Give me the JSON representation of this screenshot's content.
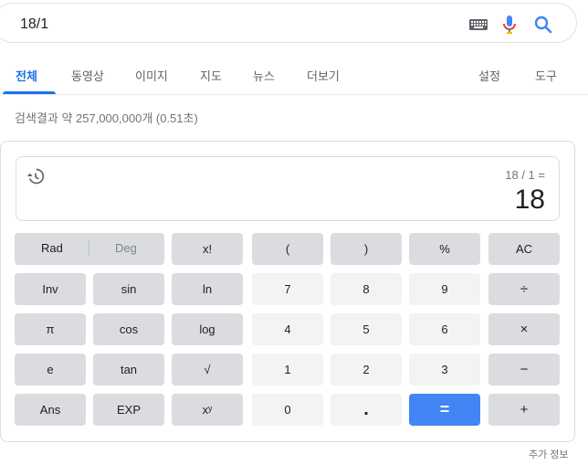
{
  "search": {
    "query": "18/1"
  },
  "tabs": [
    {
      "label": "전체",
      "active": true
    },
    {
      "label": "동영상"
    },
    {
      "label": "이미지"
    },
    {
      "label": "지도"
    },
    {
      "label": "뉴스"
    },
    {
      "label": "더보기"
    },
    {
      "label": "설정"
    },
    {
      "label": "도구"
    }
  ],
  "result_stats": "검색결과 약 257,000,000개 (0.51초)",
  "calculator": {
    "expression": "18 / 1 =",
    "result": "18",
    "rad_label": "Rad",
    "deg_label": "Deg",
    "buttons": {
      "fact": "x!",
      "lparen": "(",
      "rparen": ")",
      "percent": "%",
      "ac": "AC",
      "inv": "Inv",
      "sin": "sin",
      "ln": "ln",
      "seven": "7",
      "eight": "8",
      "nine": "9",
      "divide": "÷",
      "pi": "π",
      "cos": "cos",
      "log": "log",
      "four": "4",
      "five": "5",
      "six": "6",
      "multiply": "×",
      "e": "e",
      "tan": "tan",
      "sqrt": "√",
      "one": "1",
      "two": "2",
      "three": "3",
      "minus": "−",
      "ans": "Ans",
      "exp": "EXP",
      "pow": "xʸ",
      "zero": "0",
      "dot": ".",
      "equals": "=",
      "plus": "+"
    }
  },
  "more_info": "추가 정보",
  "colors": {
    "accent": "#1a73e8",
    "equals_button": "#4285f4"
  }
}
